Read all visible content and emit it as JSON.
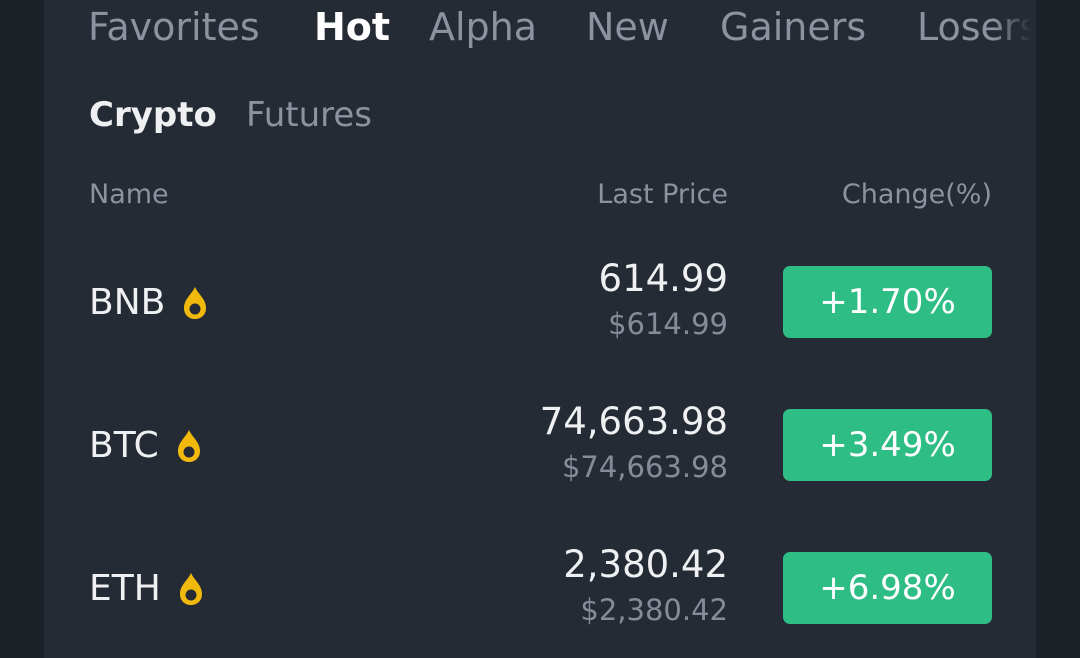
{
  "tabs": [
    {
      "label": "Favorites"
    },
    {
      "label": "Hot"
    },
    {
      "label": "Alpha"
    },
    {
      "label": "New"
    },
    {
      "label": "Gainers"
    },
    {
      "label": "Losers"
    }
  ],
  "active_tab": "Hot",
  "subtabs": [
    {
      "label": "Crypto"
    },
    {
      "label": "Futures"
    }
  ],
  "active_subtab": "Crypto",
  "columns": {
    "name": "Name",
    "last_price": "Last Price",
    "change": "Change(%)"
  },
  "rows": [
    {
      "symbol": "BNB",
      "price": "614.99",
      "fiat_price": "$614.99",
      "change": "+1.70%",
      "icon": "hot-flame-icon"
    },
    {
      "symbol": "BTC",
      "price": "74,663.98",
      "fiat_price": "$74,663.98",
      "change": "+3.49%",
      "icon": "hot-flame-icon"
    },
    {
      "symbol": "ETH",
      "price": "2,380.42",
      "fiat_price": "$2,380.42",
      "change": "+6.98%",
      "icon": "hot-flame-icon"
    }
  ],
  "colors": {
    "positive": "#2ebd85",
    "hot_icon": "#f0b90b",
    "background": "#252b35"
  }
}
